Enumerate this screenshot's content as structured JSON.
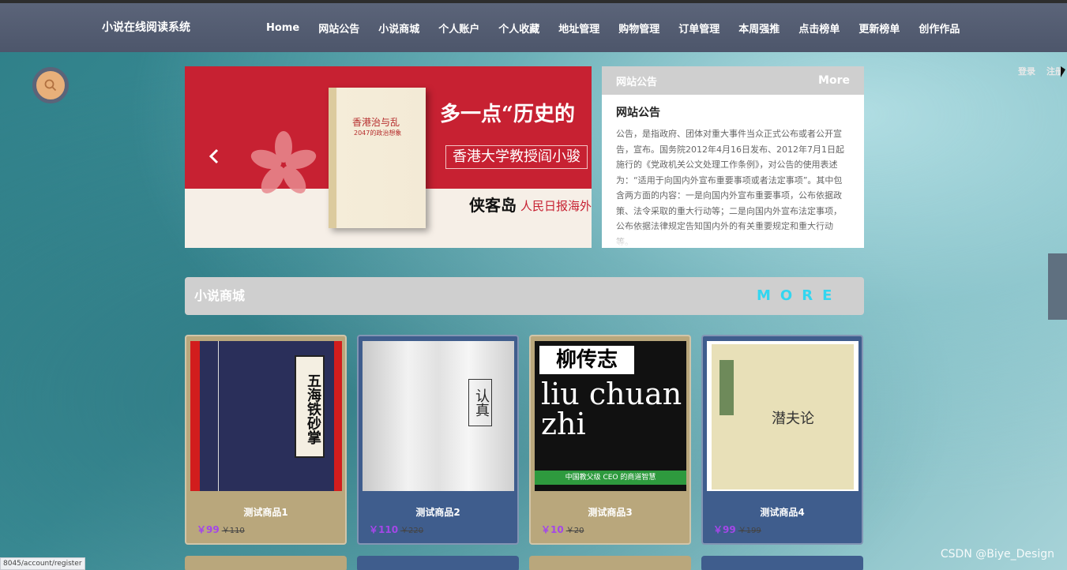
{
  "header": {
    "brand": "小说在线阅读系统",
    "nav": [
      "Home",
      "网站公告",
      "小说商城",
      "个人账户",
      "个人收藏",
      "地址管理",
      "购物管理",
      "订单管理",
      "本周强推",
      "点击榜单",
      "更新榜单",
      "创作作品"
    ]
  },
  "auth": {
    "login": "登录",
    "register": "注册"
  },
  "banner": {
    "book_title": "香港治与乱",
    "book_sub": "2047的政治想象",
    "slogan": "多一点“历史的",
    "subtitle": "香港大学教授阎小骏",
    "logo": "侠客岛",
    "logo2": "人民日报海外",
    "prev_icon": "chevron-left-icon"
  },
  "notice": {
    "header": "网站公告",
    "more": "More",
    "title": "网站公告",
    "body": "公告，是指政府、团体对重大事件当众正式公布或者公开宣告，宣布。国务院2012年4月16日发布、2012年7月1日起施行的《党政机关公文处理工作条例》，对公告的使用表述为：“适用于向国内外宣布重要事项或者法定事项”。其中包含两方面的内容：一是向国内外宣布重要事项，公布依据政策、法令采取的重大行动等；二是向国内外宣布法定事项，公布依据法律规定告知国内外的有关重要规定和重大行动等。"
  },
  "section": {
    "title": "小说商城",
    "more": "MORE"
  },
  "products": [
    {
      "name": "测试商品1",
      "price": "￥99",
      "old_price": "￥110",
      "cover_text": "五海铁砂掌"
    },
    {
      "name": "测试商品2",
      "price": "￥110",
      "old_price": "￥220",
      "cover_text": "认真"
    },
    {
      "name": "测试商品3",
      "price": "￥10",
      "old_price": "￥20",
      "cover_text": "柳传志",
      "cover_en": "liu chuan zhi",
      "cover_bar": "中国教父级 CEO 的商道智慧"
    },
    {
      "name": "测试商品4",
      "price": "￥99",
      "old_price": "￥199",
      "cover_text": "潜夫论"
    }
  ],
  "status_url": "8045/account/register",
  "watermark": "CSDN @Biye_Design",
  "colors": {
    "header": "#4d566b",
    "price": "#a447e8",
    "more": "#33d6f0",
    "card_tan": "#b9a77c",
    "card_blue": "#3f5d8d"
  }
}
